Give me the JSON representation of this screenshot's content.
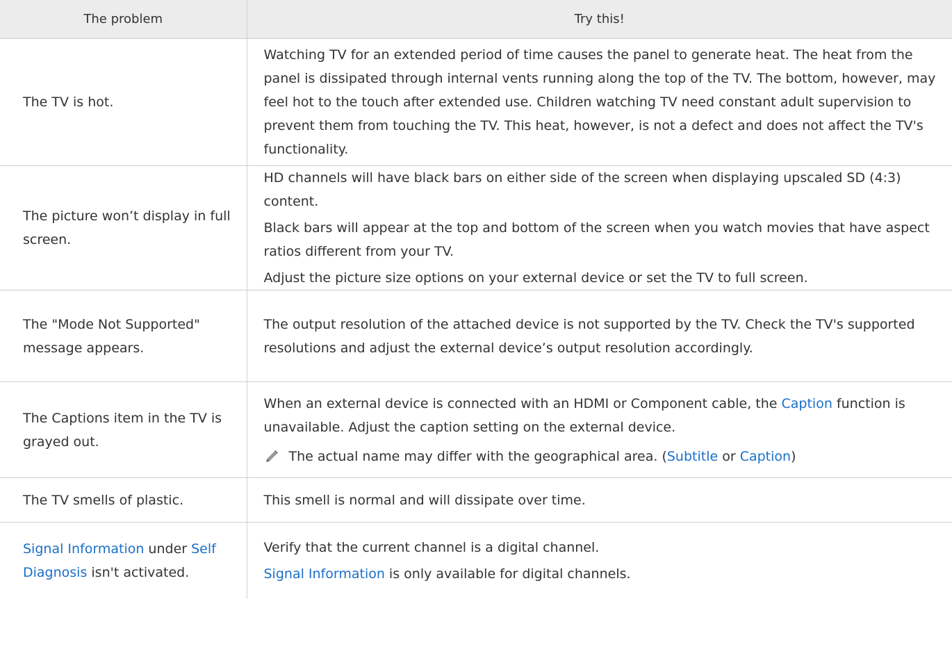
{
  "header": {
    "problem": "The problem",
    "try": "Try this!"
  },
  "rows": [
    {
      "problem": "The TV is hot.",
      "solution": "Watching TV for an extended period of time causes the panel to generate heat. The heat from the panel is dissipated through internal vents running along the top of the TV. The bottom, however, may feel hot to the touch after extended use. Children watching TV need constant adult supervision to prevent them from touching the TV. This heat, however, is not a defect and does not affect the TV's functionality."
    },
    {
      "problem": "The picture won’t display in full screen.",
      "solution_1": "HD channels will have black bars on either side of the screen when displaying upscaled SD (4:3) content.",
      "solution_2": "Black bars will appear at the top and bottom of the screen when you watch movies that have aspect ratios different from your TV.",
      "solution_3": "Adjust the picture size options on your external device or set the TV to full screen."
    },
    {
      "problem": "The \"Mode Not Supported\" message appears.",
      "solution": "The output resolution of the attached device is not supported by the TV. Check the TV's supported resolutions and adjust the external device’s output resolution accordingly."
    },
    {
      "problem": "The Captions item in the TV is grayed out.",
      "solution_pre": "When an external device is connected with an HDMI or Component cable, the ",
      "solution_link": "Caption",
      "solution_post": " function is unavailable. Adjust the caption setting on the external device.",
      "note_text": "The actual name may differ with the geographical area. (",
      "note_link1": "Subtitle",
      "note_or": " or ",
      "note_link2": "Caption",
      "note_end": ")",
      "note_icon": "pencil-note-icon"
    },
    {
      "problem": "The TV smells of plastic.",
      "solution": "This smell is normal and will dissipate over time."
    },
    {
      "problem_link1": "Signal Information",
      "problem_mid": " under ",
      "problem_link2": "Self Diagnosis",
      "problem_end": " isn't activated.",
      "solution_1": "Verify that the current channel is a digital channel.",
      "solution_2_link": "Signal Information",
      "solution_2_text": " is only available for digital channels."
    }
  ],
  "colors": {
    "link": "#1a6fc9",
    "header_bg": "#ececec",
    "border": "#cfcfcf",
    "text": "#333333"
  }
}
